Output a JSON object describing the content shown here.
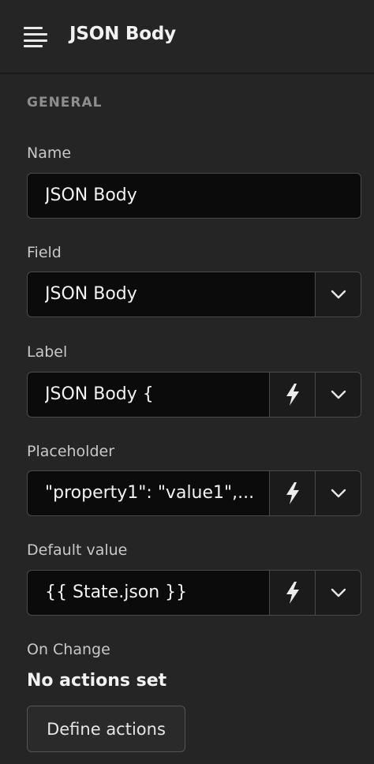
{
  "header": {
    "title": "JSON Body",
    "menu_icon": "menu-lines-icon"
  },
  "section": {
    "title": "GENERAL"
  },
  "fields": {
    "name": {
      "label": "Name",
      "value": "JSON Body"
    },
    "field": {
      "label": "Field",
      "value": "JSON Body"
    },
    "label": {
      "label": "Label",
      "value": "JSON Body {"
    },
    "placeholder": {
      "label": "Placeholder",
      "value": "\"property1\": \"value1\",..."
    },
    "default_value": {
      "label": "Default value",
      "value": "{{ State.json }}"
    }
  },
  "on_change": {
    "label": "On Change",
    "status": "No actions set",
    "button_label": "Define actions"
  },
  "icons": {
    "dynamic": "lightning-bolt-icon",
    "dropdown": "chevron-down-icon"
  },
  "colors": {
    "background": "#252525",
    "input_bg": "#0b0b0b",
    "border": "#4a4a4a",
    "text": "#f2f2f2",
    "muted": "#8e8e8e"
  }
}
